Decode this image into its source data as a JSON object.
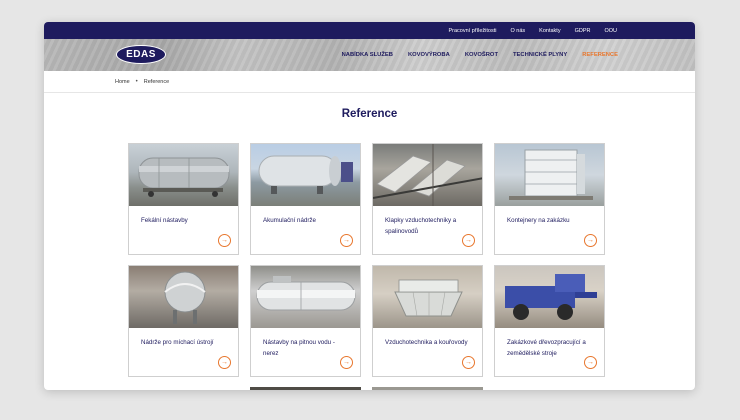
{
  "topbar": {
    "links": [
      "Pracovní příležitosti",
      "O nás",
      "Kontakty",
      "GDPR",
      "OOU"
    ]
  },
  "header": {
    "logo": "EDAS",
    "nav": [
      "NABÍDKA SLUŽEB",
      "KOVOVÝROBA",
      "KOVOŠROT",
      "TECHNICKÉ PLYNY",
      "REFERENCE"
    ],
    "active_nav": "REFERENCE"
  },
  "breadcrumb": {
    "home": "Home",
    "separator": "•",
    "current": "Reference"
  },
  "page": {
    "title": "Reference"
  },
  "cards": [
    {
      "label": "Fekální nástavby"
    },
    {
      "label": "Akumulační nádrže"
    },
    {
      "label": "Klapky vzduchotechniky a spalinovodů"
    },
    {
      "label": "Kontejnery na zakázku"
    },
    {
      "label": "Nádrže pro míchací ústrojí"
    },
    {
      "label": "Nástavby na pitnou vodu - nerez"
    },
    {
      "label": "Vzduchotechnika a kouřovody"
    },
    {
      "label": "Zakázkové dřevozpracující a zemědělské stroje"
    }
  ],
  "icons": {
    "card_arrow": "arrow-right-icon"
  },
  "colors": {
    "brand_navy": "#1e1b5e",
    "accent_orange": "#e8772e"
  }
}
